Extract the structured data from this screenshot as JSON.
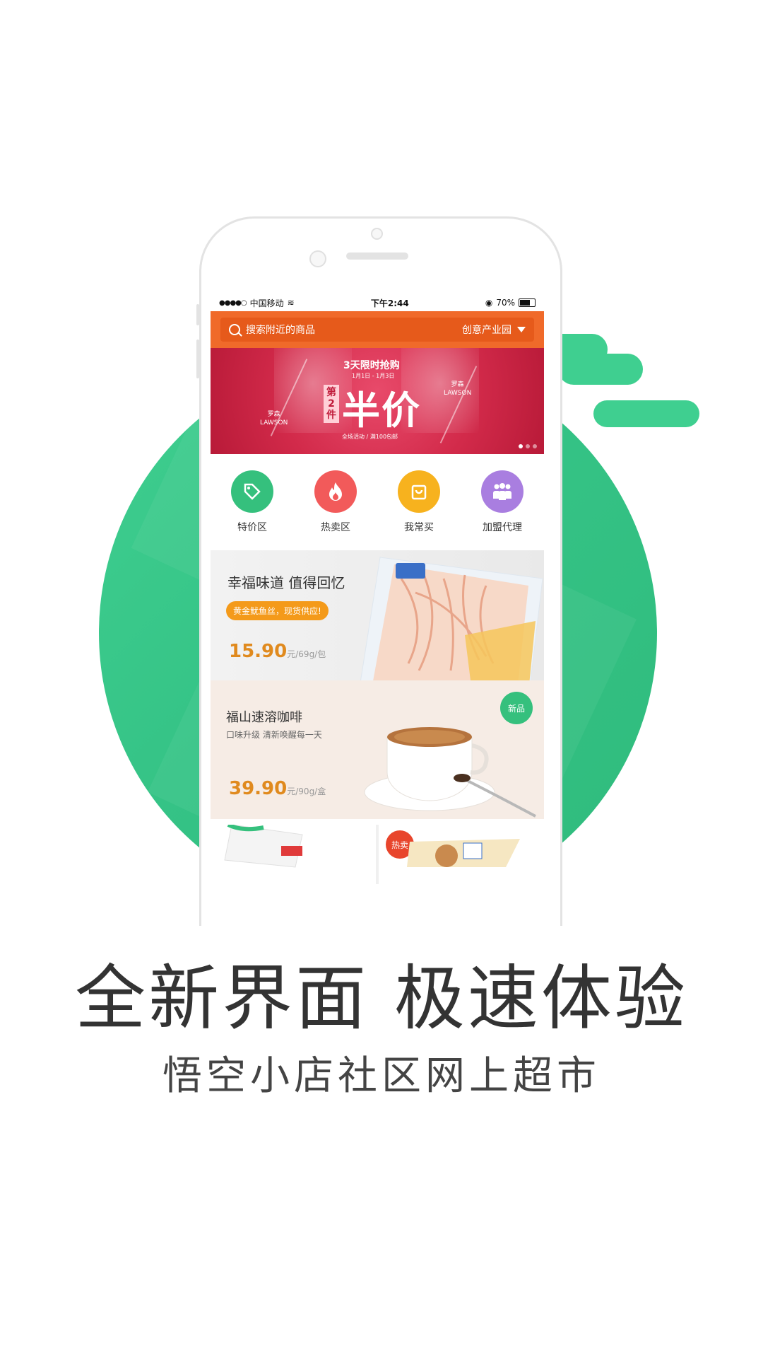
{
  "status_bar": {
    "carrier": "中国移动",
    "time": "下午2:44",
    "battery": "70%"
  },
  "search": {
    "placeholder": "搜索附近的商品",
    "location": "创意产业园"
  },
  "banner": {
    "headline": "3天限时抢购",
    "dates": "1月1日 - 1月3日",
    "tag": "第2件",
    "big_text": "半价",
    "subtext": "全场活动 / 满100包邮",
    "brand_cn": "罗森",
    "brand_en": "LAWSON",
    "slides": 3,
    "active_slide": 1
  },
  "quick_nav": [
    {
      "label": "特价区",
      "icon": "tag-icon",
      "color": "#35c07d"
    },
    {
      "label": "热卖区",
      "icon": "flame-icon",
      "color": "#f25a5a"
    },
    {
      "label": "我常买",
      "icon": "bag-icon",
      "color": "#f7b21e"
    },
    {
      "label": "加盟代理",
      "icon": "people-icon",
      "color": "#a97ee0"
    }
  ],
  "promo1": {
    "title": "幸福味道 值得回忆",
    "pill": "黄金鱿鱼丝，现货供应!",
    "price": "15.90",
    "unit": "元/69g/包"
  },
  "promo2": {
    "title": "福山速溶咖啡",
    "subtitle": "口味升级 清新唤醒每一天",
    "price": "39.90",
    "unit": "元/90g/盒",
    "badge": "新品"
  },
  "tiles": {
    "hot_badge": "热卖"
  },
  "caption": {
    "main": "全新界面 极速体验",
    "sub": "悟空小店社区网上超市"
  },
  "colors": {
    "brand_green": "#3fcf90",
    "header_orange": "#f06a2a",
    "price_orange": "#e08a1e"
  }
}
